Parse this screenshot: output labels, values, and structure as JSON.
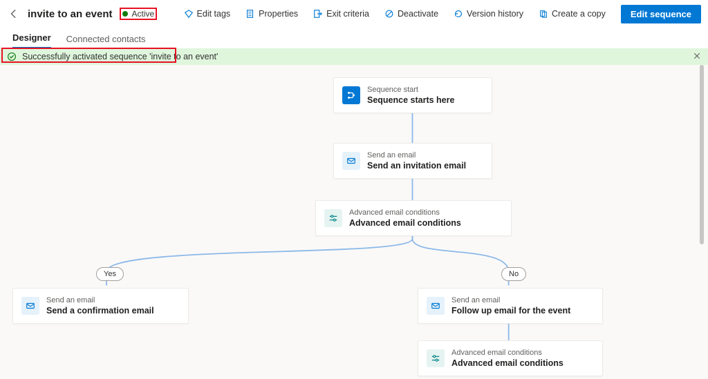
{
  "header": {
    "title": "invite to an event",
    "status_label": "Active",
    "status_color": "#107c10"
  },
  "commands": {
    "edit_tags": "Edit tags",
    "properties": "Properties",
    "exit_criteria": "Exit criteria",
    "deactivate": "Deactivate",
    "version_history": "Version history",
    "create_copy": "Create a copy",
    "edit_sequence": "Edit sequence"
  },
  "tabs": {
    "designer": "Designer",
    "connected_contacts": "Connected contacts"
  },
  "notification": {
    "message": "Successfully activated sequence 'invite to an event'"
  },
  "branches": {
    "yes": "Yes",
    "no": "No"
  },
  "nodes": {
    "start": {
      "type": "Sequence start",
      "title": "Sequence starts here"
    },
    "email1": {
      "type": "Send an email",
      "title": "Send an invitation email"
    },
    "cond1": {
      "type": "Advanced email conditions",
      "title": "Advanced email conditions"
    },
    "yes_email": {
      "type": "Send an email",
      "title": "Send a confirmation email"
    },
    "no_email": {
      "type": "Send an email",
      "title": "Follow up email for the event"
    },
    "cond2": {
      "type": "Advanced email conditions",
      "title": "Advanced email conditions"
    }
  }
}
